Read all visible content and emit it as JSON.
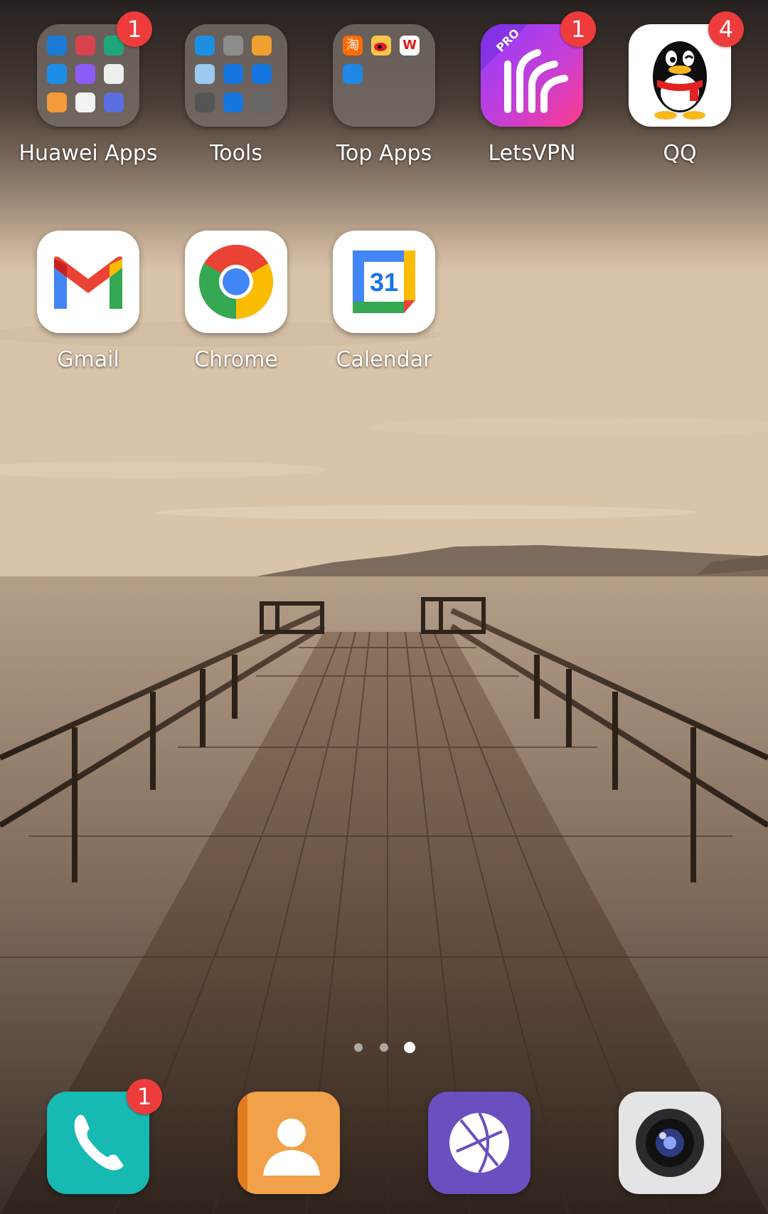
{
  "home": {
    "page_indicator": {
      "pages": 3,
      "current": 3
    },
    "apps_row1": [
      {
        "label": "Huawei Apps",
        "badge": "1",
        "icon": "huawei-apps-folder-icon"
      },
      {
        "label": "Tools",
        "badge": "",
        "icon": "tools-folder-icon"
      },
      {
        "label": "Top Apps",
        "badge": "",
        "icon": "top-apps-folder-icon"
      },
      {
        "label": "LetsVPN",
        "badge": "1",
        "icon": "letsvpn-icon"
      },
      {
        "label": "QQ",
        "badge": "4",
        "icon": "qq-icon"
      }
    ],
    "apps_row2": [
      {
        "label": "Gmail",
        "icon": "gmail-icon"
      },
      {
        "label": "Chrome",
        "icon": "chrome-icon"
      },
      {
        "label": "Calendar",
        "icon": "calendar-icon",
        "calendar_day": "31"
      }
    ],
    "letsvpn_ribbon": "PRO",
    "top_apps_glyphs": {
      "taobao": "淘",
      "wps": "W"
    }
  },
  "dock": [
    {
      "icon": "phone-icon",
      "badge": "1"
    },
    {
      "icon": "contacts-icon",
      "badge": ""
    },
    {
      "icon": "browser-icon",
      "badge": ""
    },
    {
      "icon": "camera-icon",
      "badge": ""
    }
  ],
  "colors": {
    "badge": "#ee3b3b",
    "phone": "#17b9b3",
    "contacts": "#f1a14a",
    "browser": "#6a4fc1",
    "camera": "#e4e4e6",
    "letsvpn_from": "#a23dff",
    "letsvpn_to": "#ff3c8a"
  }
}
